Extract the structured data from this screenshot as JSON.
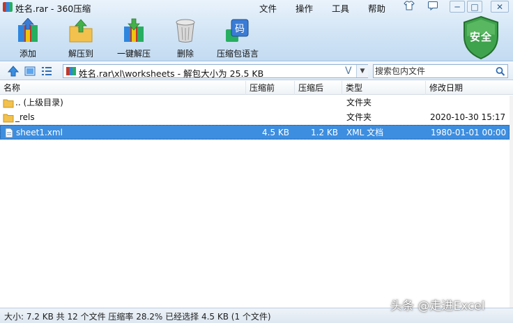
{
  "window": {
    "title": "姓名.rar - 360压缩"
  },
  "menu": {
    "items": [
      "文件",
      "操作",
      "工具",
      "帮助"
    ]
  },
  "window_controls": {
    "shirt_icon": "shirt-icon",
    "chat_icon": "message-icon",
    "minimize": "─",
    "maximize": "□",
    "close": "✕"
  },
  "toolbar": {
    "add_label": "添加",
    "extract_to_label": "解压到",
    "one_click_extract_label": "一键解压",
    "delete_label": "删除",
    "language_label": "压缩包语言",
    "language_icon_text": "码"
  },
  "security": {
    "badge_text": "安全",
    "color": "#3fa34d"
  },
  "address": {
    "path": "姓名.rar\\xl\\worksheets - 解包大小为 25.5 KB",
    "v_mark": "V"
  },
  "search": {
    "placeholder": "搜索包内文件"
  },
  "columns": [
    "名称",
    "压缩前",
    "压缩后",
    "类型",
    "修改日期"
  ],
  "files": [
    {
      "name": ".. (上级目录)",
      "before": "",
      "after": "",
      "type": "文件夹",
      "date": ""
    },
    {
      "name": "_rels",
      "before": "",
      "after": "",
      "type": "文件夹",
      "date": "2020-10-30 15:17"
    },
    {
      "name": "sheet1.xml",
      "before": "4.5 KB",
      "after": "1.2 KB",
      "type": "XML 文档",
      "date": "1980-01-01 00:00"
    }
  ],
  "status": {
    "text": "大小: 7.2 KB 共 12 个文件 压缩率 28.2% 已经选择 4.5 KB (1 个文件)"
  },
  "watermark": {
    "text": "头条 @走进Excel"
  },
  "colors": {
    "selection": "#3d8ee0",
    "folder": "#f2c14e",
    "accent": "#2e6db4"
  }
}
